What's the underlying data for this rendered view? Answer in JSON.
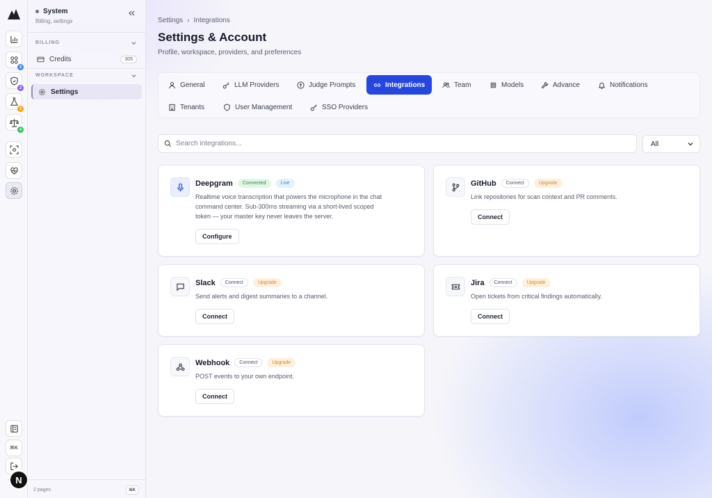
{
  "rail": {
    "badges": [
      "3",
      "2",
      "2",
      "4"
    ],
    "kbd": "⌘K",
    "avatar": "N"
  },
  "sidebar": {
    "title": "System",
    "subtitle": "Billing, settings",
    "sections": [
      {
        "label": "BILLING",
        "items": [
          {
            "label": "Credits",
            "count": "305"
          }
        ]
      },
      {
        "label": "WORKSPACE",
        "items": [
          {
            "label": "Settings"
          }
        ]
      }
    ],
    "footer_text": "2 pages",
    "footer_kbd": "⌘K"
  },
  "breadcrumb": {
    "parent": "Settings",
    "separator": "›",
    "current": "Integrations"
  },
  "page": {
    "title": "Settings & Account",
    "subtitle": "Profile, workspace, providers, and preferences"
  },
  "tabs": [
    {
      "label": "General",
      "icon": "user-icon"
    },
    {
      "label": "LLM Providers",
      "icon": "key-icon"
    },
    {
      "label": "Judge Prompts",
      "icon": "scale-icon"
    },
    {
      "label": "Integrations",
      "icon": "link-icon",
      "active": true
    },
    {
      "label": "Team",
      "icon": "users-icon"
    },
    {
      "label": "Models",
      "icon": "cpu-icon"
    },
    {
      "label": "Advance",
      "icon": "wrench-icon"
    },
    {
      "label": "Notifications",
      "icon": "bell-icon"
    },
    {
      "label": "Tenants",
      "icon": "building-icon"
    },
    {
      "label": "User Management",
      "icon": "shield-icon"
    },
    {
      "label": "SSO Providers",
      "icon": "key-icon"
    }
  ],
  "search": {
    "placeholder": "Search integrations..."
  },
  "filter": {
    "value": "All"
  },
  "integrations": [
    {
      "name": "Deepgram",
      "icon": "microphone-icon",
      "badges": [
        "Connected",
        "Live"
      ],
      "desc": [
        "Realtime voice transcription that powers the microphone in the chat",
        "command center. Sub-300ms streaming via a short-lived scoped",
        "token — your master key never leaves the server."
      ],
      "button": "Configure"
    },
    {
      "name": "GitHub",
      "icon": "git-branch-icon",
      "badges": [
        "Connect",
        "Upgrade"
      ],
      "desc": [
        "Link repositories for scan context and PR comments."
      ],
      "button": "Connect"
    },
    {
      "name": "Slack",
      "icon": "message-icon",
      "badges": [
        "Connect",
        "Upgrade"
      ],
      "desc": [
        "Send alerts and digest summaries to a channel."
      ],
      "button": "Connect"
    },
    {
      "name": "Jira",
      "icon": "ticket-icon",
      "badges": [
        "Connect",
        "Upgrade"
      ],
      "desc": [
        "Open tickets from critical findings automatically."
      ],
      "button": "Connect"
    },
    {
      "name": "Webhook",
      "icon": "webhook-icon",
      "badges": [
        "Connect",
        "Upgrade"
      ],
      "desc": [
        "POST events to your own endpoint."
      ],
      "button": "Connect"
    }
  ],
  "colors": {
    "accent": "#2547e0",
    "connected": "#2f8a4a",
    "upgrade": "#d58a2a"
  }
}
